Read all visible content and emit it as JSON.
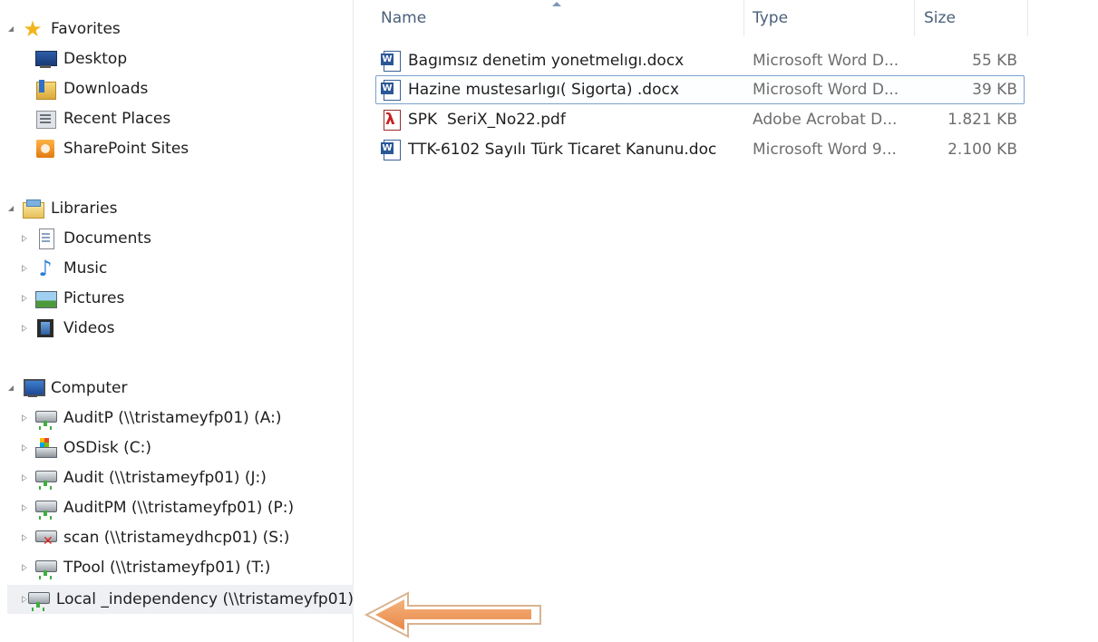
{
  "navigation": {
    "favorites": {
      "label": "Favorites",
      "items": [
        {
          "label": "Desktop",
          "icon": "desktop-icon"
        },
        {
          "label": "Downloads",
          "icon": "downloads-icon"
        },
        {
          "label": "Recent Places",
          "icon": "recent-places-icon"
        },
        {
          "label": "SharePoint Sites",
          "icon": "sharepoint-icon"
        }
      ]
    },
    "libraries": {
      "label": "Libraries",
      "items": [
        {
          "label": "Documents",
          "icon": "documents-icon"
        },
        {
          "label": "Music",
          "icon": "music-icon"
        },
        {
          "label": "Pictures",
          "icon": "pictures-icon"
        },
        {
          "label": "Videos",
          "icon": "videos-icon"
        }
      ]
    },
    "computer": {
      "label": "Computer",
      "items": [
        {
          "label": "AuditP (\\\\tristameyfp01) (A:)",
          "icon": "network-drive-icon"
        },
        {
          "label": "OSDisk (C:)",
          "icon": "os-disk-icon"
        },
        {
          "label": "Audit (\\\\tristameyfp01) (J:)",
          "icon": "network-drive-icon"
        },
        {
          "label": "AuditPM (\\\\tristameyfp01) (P:)",
          "icon": "network-drive-icon"
        },
        {
          "label": "scan (\\\\tristameydhcp01) (S:)",
          "icon": "disconnected-network-drive-icon"
        },
        {
          "label": "TPool (\\\\tristameyfp01) (T:)",
          "icon": "network-drive-icon"
        },
        {
          "label": "Local _independency (\\\\tristameyfp01)",
          "icon": "network-drive-icon"
        }
      ]
    }
  },
  "file_list": {
    "columns": {
      "name": "Name",
      "type": "Type",
      "size": "Size"
    },
    "sort_column": "Name",
    "files": [
      {
        "name": "Bagımsız denetim yonetmelıgı.docx",
        "type": "Microsoft Word D...",
        "size": "55 KB",
        "icon": "word-document-icon"
      },
      {
        "name": "Hazine mustesarlıgı( Sigorta) .docx",
        "type": "Microsoft Word D...",
        "size": "39 KB",
        "icon": "word-document-icon",
        "selected": true
      },
      {
        "name": "SPK  SeriX_No22.pdf",
        "type": "Adobe Acrobat D...",
        "size": "1.821 KB",
        "icon": "pdf-document-icon"
      },
      {
        "name": "TTK-6102 Sayılı Türk Ticaret Kanunu.doc",
        "type": "Microsoft Word 9...",
        "size": "2.100 KB",
        "icon": "word-document-icon"
      }
    ]
  },
  "colors": {
    "nav_highlight": "#eef0f3",
    "selection_border": "#7da2ce",
    "column_header_text": "#4c607a",
    "annotation_arrow": "#f0a060"
  }
}
